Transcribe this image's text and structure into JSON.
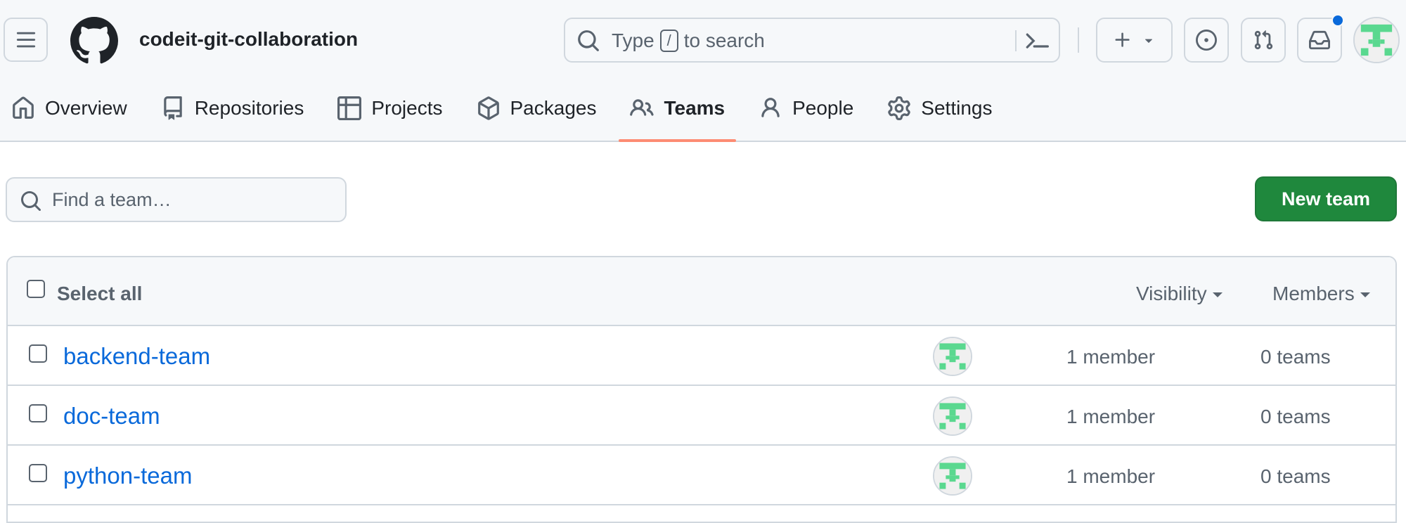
{
  "header": {
    "org_name": "codeit-git-collaboration",
    "search": {
      "prefix": "Type",
      "key": "/",
      "suffix": "to search"
    },
    "icons": [
      "hamburger-icon",
      "github-logo",
      "search-icon",
      "command-palette-icon",
      "plus-icon",
      "issue-icon",
      "pull-request-icon",
      "inbox-icon"
    ],
    "notification_color": "#0969da"
  },
  "tabs": [
    {
      "label": "Overview",
      "icon": "home-icon"
    },
    {
      "label": "Repositories",
      "icon": "repo-icon"
    },
    {
      "label": "Projects",
      "icon": "table-icon"
    },
    {
      "label": "Packages",
      "icon": "package-icon"
    },
    {
      "label": "Teams",
      "icon": "people-icon",
      "active": true
    },
    {
      "label": "People",
      "icon": "person-icon"
    },
    {
      "label": "Settings",
      "icon": "gear-icon"
    }
  ],
  "toolbar": {
    "find_placeholder": "Find a team…",
    "new_team_label": "New team"
  },
  "table": {
    "select_all_label": "Select all",
    "visibility_label": "Visibility",
    "members_filter_label": "Members",
    "rows": [
      {
        "name": "backend-team",
        "members": "1 member",
        "teams": "0 teams"
      },
      {
        "name": "doc-team",
        "members": "1 member",
        "teams": "0 teams"
      },
      {
        "name": "python-team",
        "members": "1 member",
        "teams": "0 teams"
      }
    ]
  },
  "colors": {
    "accent_link": "#0969da",
    "primary_button": "#1f883d",
    "active_tab_underline": "#fd8c73",
    "avatar_green": "#5ad88f"
  }
}
